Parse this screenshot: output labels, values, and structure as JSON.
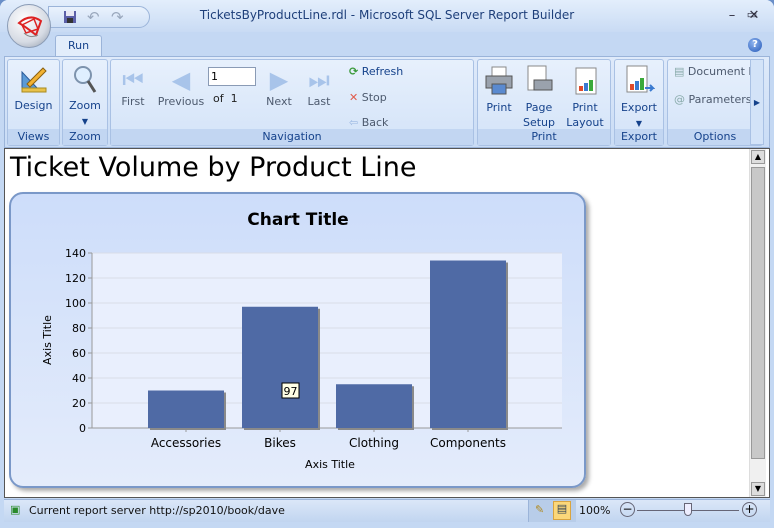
{
  "window": {
    "title": "TicketsByProductLine.rdl - Microsoft SQL Server Report Builder",
    "controls": [
      "minimize",
      "maximize",
      "close"
    ]
  },
  "qat": {
    "icons": [
      "save-icon",
      "undo-icon",
      "redo-icon"
    ]
  },
  "tabs": [
    {
      "label": "Run",
      "active": true
    }
  ],
  "ribbon": {
    "views": {
      "label": "Views",
      "design": "Design"
    },
    "zoom": {
      "label": "Zoom",
      "zoom": "Zoom"
    },
    "navigation": {
      "label": "Navigation",
      "first": "First",
      "previous": "Previous",
      "page_value": "1",
      "of": "of",
      "total": "1",
      "next": "Next",
      "last": "Last",
      "refresh": "Refresh",
      "stop": "Stop",
      "back": "Back"
    },
    "print": {
      "label": "Print",
      "print": "Print",
      "page_setup_1": "Page",
      "page_setup_2": "Setup",
      "print_layout_1": "Print",
      "print_layout_2": "Layout"
    },
    "export": {
      "label": "Export",
      "export": "Export"
    },
    "options": {
      "label": "Options",
      "document_map": "Document M",
      "parameters": "Parameters"
    }
  },
  "report": {
    "title": "Ticket Volume by Product Line",
    "tooltip": "97"
  },
  "chart_data": {
    "type": "bar",
    "title": "Chart Title",
    "xlabel": "Axis Title",
    "ylabel": "Axis Title",
    "categories": [
      "Accessories",
      "Bikes",
      "Clothing",
      "Components"
    ],
    "values": [
      30,
      97,
      35,
      134
    ],
    "ylim": [
      0,
      140
    ],
    "yticks": [
      0,
      20,
      40,
      60,
      80,
      100,
      120,
      140
    ],
    "grid": true,
    "bar_color": "#4f6aa5"
  },
  "status": {
    "text": "Current report server http://sp2010/book/dave",
    "zoom": "100%",
    "zoom_fraction": 0.5
  }
}
